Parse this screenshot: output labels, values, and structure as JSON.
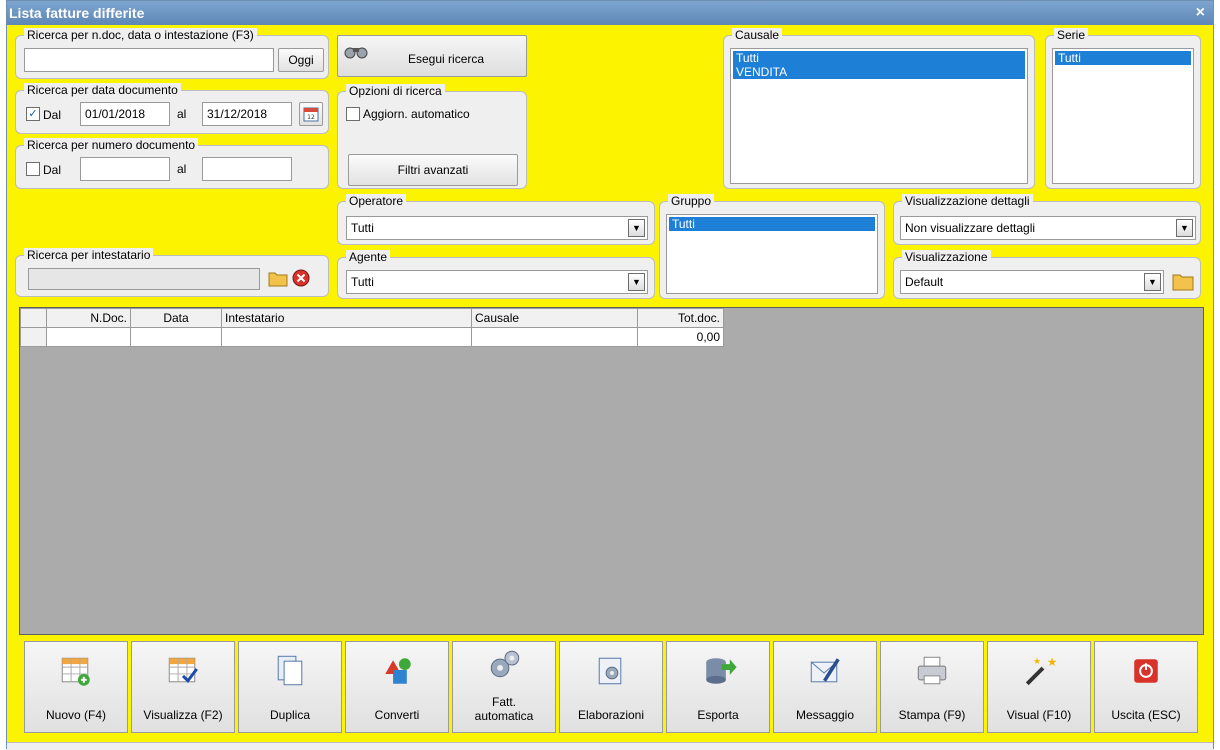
{
  "window": {
    "title": "Lista fatture differite",
    "close_glyph": "×"
  },
  "ricerca_ndoc": {
    "title": "Ricerca per n.doc, data o intestazione (F3)",
    "value": "",
    "oggi_label": "Oggi"
  },
  "ricerca_data": {
    "title": "Ricerca per data documento",
    "dal_label": "Dal",
    "dal_checked": true,
    "dal_value": "01/01/2018",
    "al_label": "al",
    "al_value": "31/12/2018",
    "calendar_icon": "calendar-icon"
  },
  "ricerca_numero": {
    "title": "Ricerca per numero documento",
    "dal_label": "Dal",
    "dal_checked": false,
    "dal_value": "",
    "al_label": "al",
    "al_value": ""
  },
  "esegui": {
    "label": "Esegui ricerca",
    "icon": "binoculars-icon"
  },
  "opzioni": {
    "title": "Opzioni di ricerca",
    "aggiorn_label": "Aggiorn. automatico",
    "aggiorn_checked": false,
    "filtri_label": "Filtri avanzati"
  },
  "causale": {
    "title": "Causale",
    "items": [
      "Tutti",
      "VENDITA"
    ]
  },
  "serie": {
    "title": "Serie",
    "items": [
      "Tutti"
    ]
  },
  "operatore": {
    "title": "Operatore",
    "value": "Tutti"
  },
  "gruppo": {
    "title": "Gruppo",
    "items": [
      "Tutti"
    ]
  },
  "vis_dettagli": {
    "title": "Visualizzazione dettagli",
    "value": "Non visualizzare dettagli"
  },
  "intestatario": {
    "title": "Ricerca per intestatario",
    "value": ""
  },
  "agente": {
    "title": "Agente",
    "value": "Tutti"
  },
  "visualizzazione": {
    "title": "Visualizzazione",
    "value": "Default"
  },
  "grid": {
    "columns": [
      "",
      "N.Doc.",
      "Data",
      "Intestatario",
      "Causale",
      "Tot.doc."
    ],
    "rows": [
      [
        "",
        "",
        "",
        "",
        "",
        "0,00"
      ]
    ]
  },
  "toolbar": {
    "nuovo": "Nuovo (F4)",
    "visualizza": "Visualizza (F2)",
    "duplica": "Duplica",
    "converti": "Converti",
    "fatt_auto_1": "Fatt.",
    "fatt_auto_2": "automatica",
    "elaborazioni": "Elaborazioni",
    "esporta": "Esporta",
    "messaggio": "Messaggio",
    "stampa": "Stampa (F9)",
    "visual": "Visual (F10)",
    "uscita": "Uscita (ESC)"
  },
  "colors": {
    "window_bg": "#fbf300",
    "titlebar": "#6a93c2",
    "selection": "#1e7fd6",
    "grid_bg": "#ababab"
  }
}
